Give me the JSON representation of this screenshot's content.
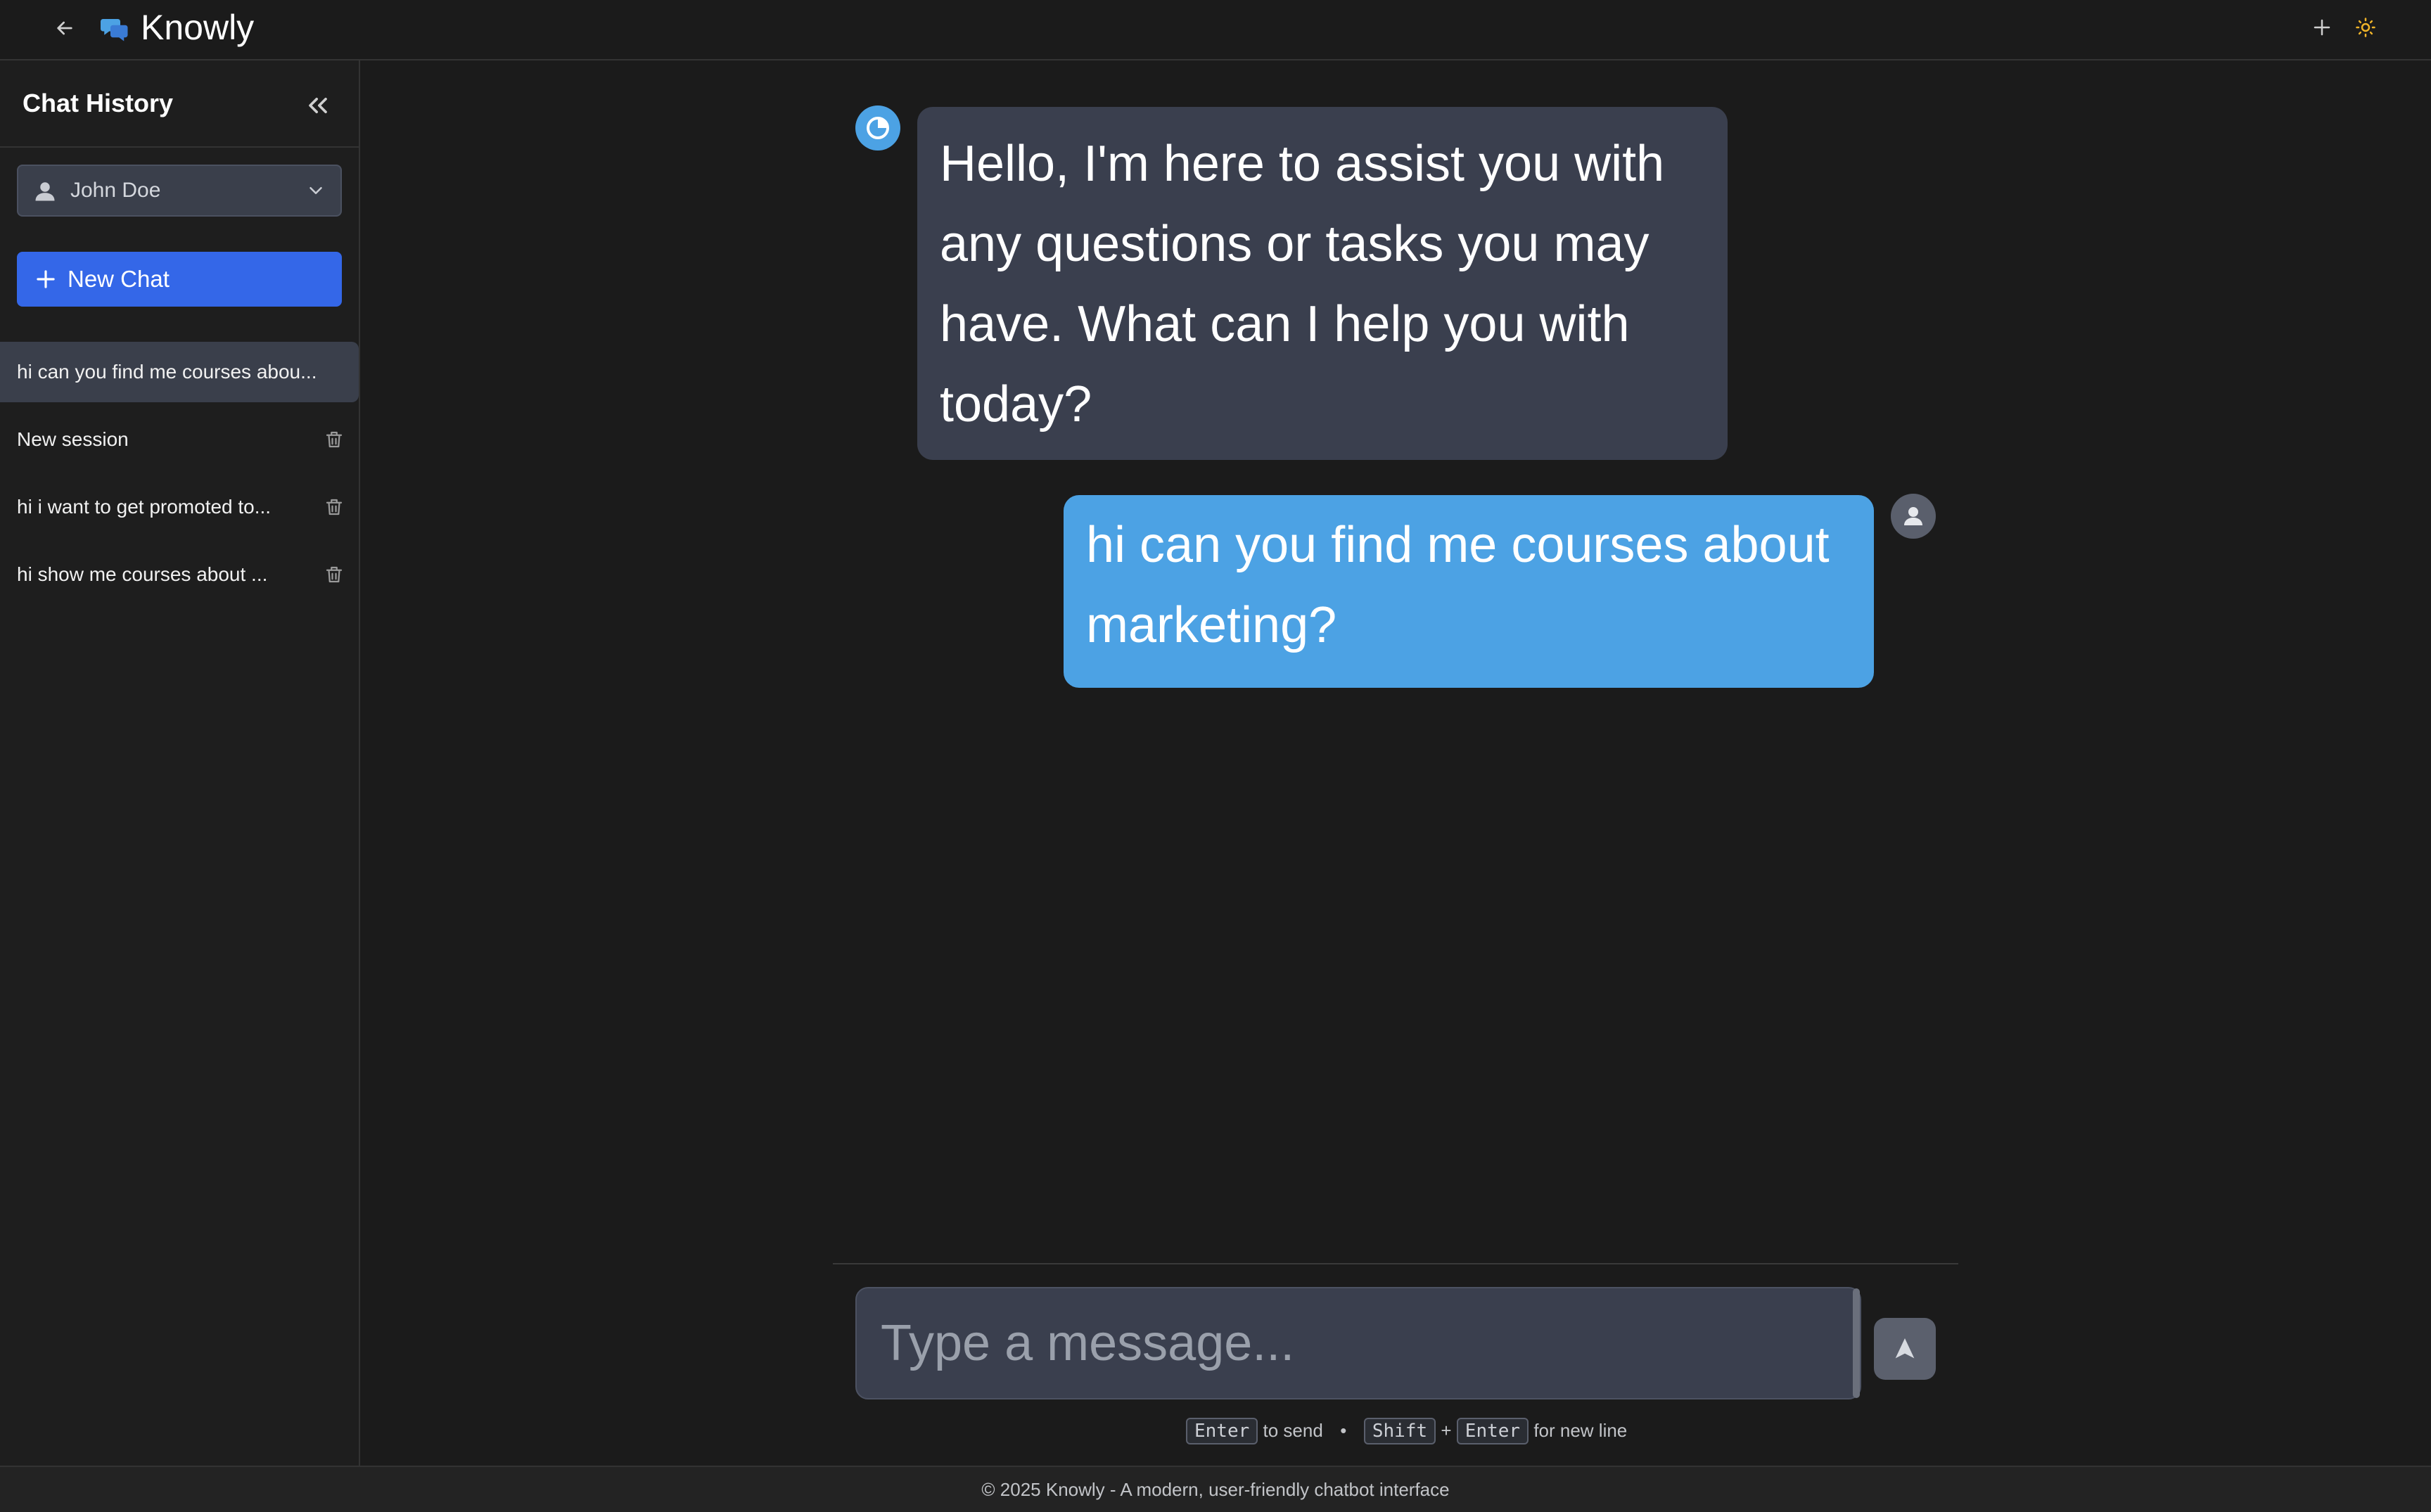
{
  "header": {
    "app_title": "Knowly",
    "back_icon": "arrow-left-icon",
    "logo_icon": "chat-bubbles-icon",
    "new_icon": "plus-icon",
    "theme_icon": "sun-icon"
  },
  "sidebar": {
    "title": "Chat History",
    "collapse_icon": "chevrons-left-icon",
    "user_select": {
      "value": "John Doe",
      "icon": "user-icon",
      "chevron": "chevron-down-icon"
    },
    "new_chat_label": "New Chat",
    "sessions": [
      {
        "label": "hi can you find me courses abou...",
        "active": true
      },
      {
        "label": "New session",
        "active": false
      },
      {
        "label": "hi i want to get promoted to...",
        "active": false
      },
      {
        "label": "hi show me courses about ...",
        "active": false
      }
    ]
  },
  "messages": [
    {
      "role": "bot",
      "text": "Hello, I'm here to assist you with any questions or tasks you may have. What can I help you with today?"
    },
    {
      "role": "user",
      "text": "hi can you find me courses about marketing?"
    }
  ],
  "composer": {
    "placeholder": "Type a message...",
    "hint": {
      "enter_key": "Enter",
      "to_send": "to send",
      "bullet": "•",
      "shift_key": "Shift",
      "plus": "+",
      "enter_key_2": "Enter",
      "new_line": "for new line"
    },
    "send_icon": "send-arrow-icon"
  },
  "footer": {
    "text": "© 2025 Knowly - A modern, user-friendly chatbot interface"
  },
  "colors": {
    "background": "#1b1b1b",
    "sidebar": "#1e1e1e",
    "primary_button": "#3467e8",
    "bot_bubble": "#3a3f4e",
    "user_bubble": "#4ca2e4",
    "accent_icon": "#f0b429"
  }
}
